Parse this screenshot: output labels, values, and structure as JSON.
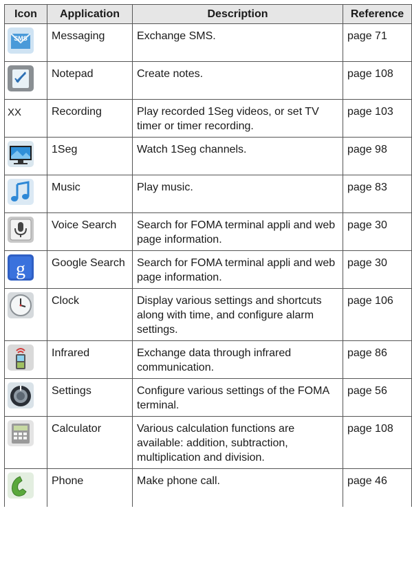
{
  "headers": [
    "Icon",
    "Application",
    "Description",
    "Reference"
  ],
  "rows": [
    {
      "icon": "sms-envelope-icon",
      "app": "Messaging",
      "desc": "Exchange SMS.",
      "ref": "page 71"
    },
    {
      "icon": "notepad-icon",
      "app": "Notepad",
      "desc": "Create notes.",
      "ref": "page 108"
    },
    {
      "icon_text": "XX",
      "app": "Recording",
      "desc": "Play recorded 1Seg videos, or set TV timer or timer recording.",
      "ref": "page 103"
    },
    {
      "icon": "tv-icon",
      "app": "1Seg",
      "desc": "Watch 1Seg channels.",
      "ref": "page 98"
    },
    {
      "icon": "music-note-icon",
      "app": "Music",
      "desc": "Play music.",
      "ref": "page 83"
    },
    {
      "icon": "microphone-icon",
      "app": "Voice Search",
      "desc": "Search for FOMA terminal appli and web page information.",
      "ref": "page 30"
    },
    {
      "icon": "google-g-icon",
      "app": "Google Search",
      "desc": "Search for FOMA terminal appli and web page information.",
      "ref": "page 30"
    },
    {
      "icon": "clock-icon",
      "app": "Clock",
      "desc": "Display various settings and shortcuts along with time, and configure alarm settings.",
      "ref": "page 106"
    },
    {
      "icon": "infrared-phone-icon",
      "app": "Infrared",
      "desc": "Exchange data through infrared communication.",
      "ref": "page 86"
    },
    {
      "icon": "settings-knob-icon",
      "app": "Settings",
      "desc": "Configure various settings of the FOMA terminal.",
      "ref": "page 56"
    },
    {
      "icon": "calculator-icon",
      "app": "Calculator",
      "desc": "Various calculation functions are available: addition, subtraction, multiplication and division.",
      "ref": "page 108"
    },
    {
      "icon": "phone-handset-icon",
      "app": "Phone",
      "desc": "Make phone call.",
      "ref": "page 46"
    }
  ]
}
